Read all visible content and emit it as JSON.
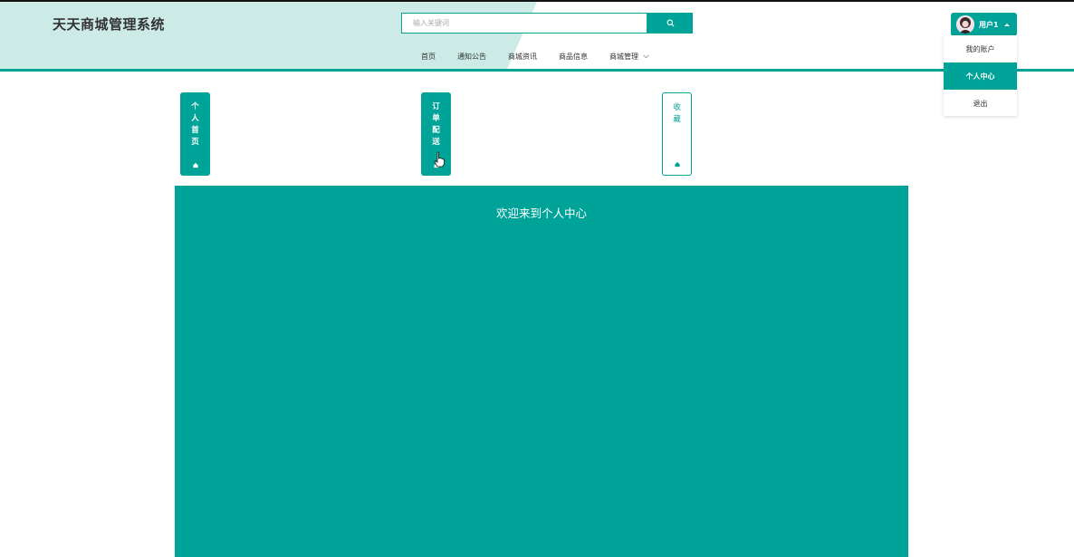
{
  "header": {
    "site_title": "天天商城管理系统",
    "search_placeholder": "输入关键词",
    "accent_color": "#00a398",
    "header_tint": "#ccebe7"
  },
  "nav": {
    "items": [
      "首页",
      "通知公告",
      "商城资讯",
      "商品信息",
      "商城管理"
    ]
  },
  "user_menu": {
    "username": "用户1",
    "items": [
      {
        "label": "我的账户",
        "active": false
      },
      {
        "label": "个人中心",
        "active": true
      },
      {
        "label": "退出",
        "active": false
      }
    ]
  },
  "cards": [
    {
      "label": "个人首页",
      "icon": "home-icon",
      "style": "filled"
    },
    {
      "label": "订单配送",
      "icon": "home-icon",
      "style": "filled"
    },
    {
      "label": "收藏",
      "icon": "home-icon",
      "style": "outline"
    }
  ],
  "main": {
    "welcome": "欢迎来到个人中心"
  }
}
